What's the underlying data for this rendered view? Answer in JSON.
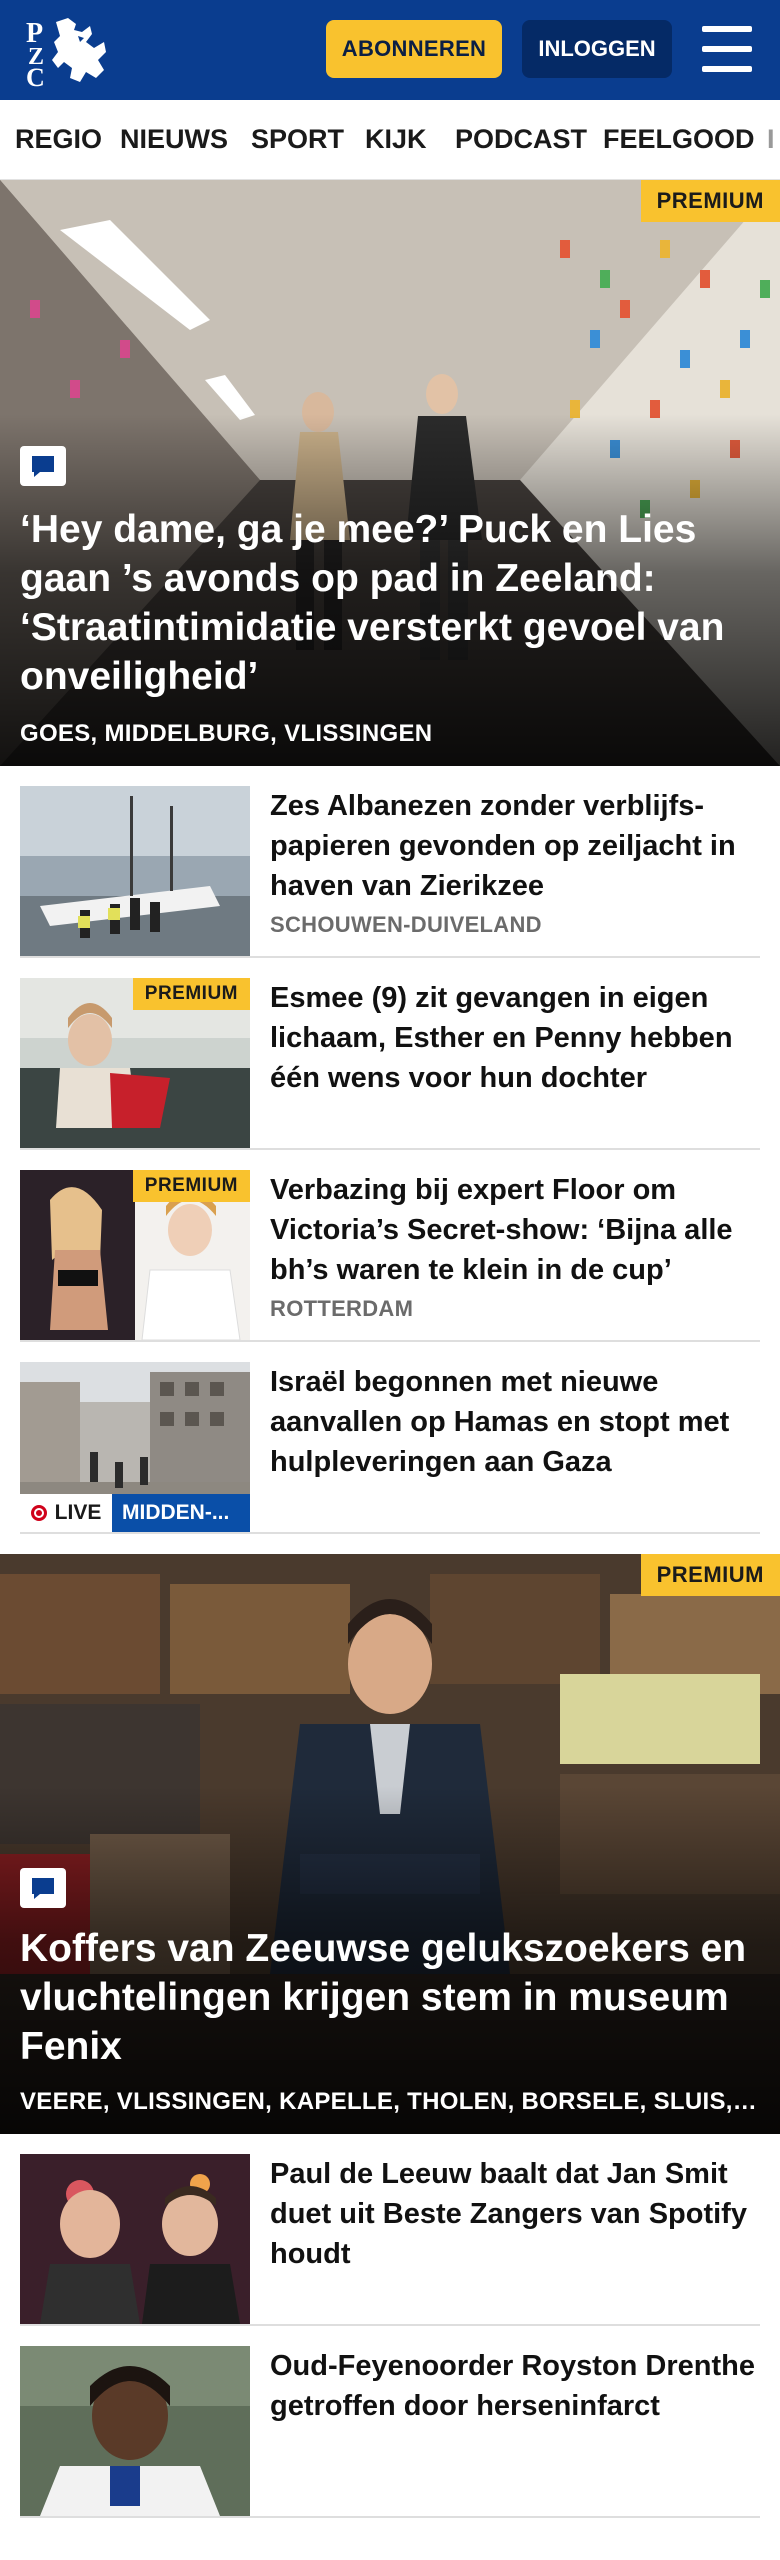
{
  "header": {
    "logo_text": "PZC",
    "subscribe_label": "ABONNEREN",
    "login_label": "INLOGGEN",
    "colors": {
      "brand_blue": "#0a3d8f",
      "accent_yellow": "#f9c22e",
      "login_blue": "#052a66"
    }
  },
  "nav": {
    "items": [
      "REGIO",
      "NIEUWS",
      "SPORT",
      "KIJK",
      "PODCAST",
      "FEELGOOD",
      "I"
    ]
  },
  "hero1": {
    "badge": "PREMIUM",
    "icon": "comment-icon",
    "title": "‘Hey dame, ga je mee?’ Puck en Lies gaan ’s avonds op pad in Zeeland: ‘Straatintimidatie versterkt gevoel van onveiligheid’",
    "tags": "GOES, MIDDELBURG, VLISSINGEN"
  },
  "articles": [
    {
      "title": "Zes Albanezen zonder verblijfs­papieren gevonden op zeiljacht in haven van Zierikzee",
      "tag": "SCHOUWEN-DUIVELAND",
      "premium": ""
    },
    {
      "title": "Esmee (9) zit gevangen in eigen lichaam, Esther en Penny hebben één wens voor hun dochter",
      "tag": "",
      "premium": "PREMIUM"
    },
    {
      "title": "Verbazing bij expert Floor om Victoria’s Secret-show: ‘Bijna alle bh’s waren te klein in de cup’",
      "tag": "ROTTERDAM",
      "premium": "PREMIUM"
    },
    {
      "title": "Israël begonnen met nieuwe aanvallen op Hamas en stopt met hulpleveringen aan Gaza",
      "tag": "",
      "premium": "",
      "live_label": "LIVE",
      "region_label": "MIDDEN-..."
    }
  ],
  "hero2": {
    "badge": "PREMIUM",
    "icon": "comment-icon",
    "title": "Koffers van Zeeuwse gelukszoekers en vluchtelingen krijgen stem in museum Fenix",
    "tags": "VEERE, VLISSINGEN, KAPELLE, THOLEN, BORSELE, SLUIS, ..."
  },
  "articles2": [
    {
      "title": "Paul de Leeuw baalt dat Jan Smit duet uit Beste Zangers van Spotify houdt",
      "tag": ""
    },
    {
      "title": "Oud-Feyenoorder Royston Drenthe getroffen door hersenin­farct",
      "tag": ""
    }
  ]
}
